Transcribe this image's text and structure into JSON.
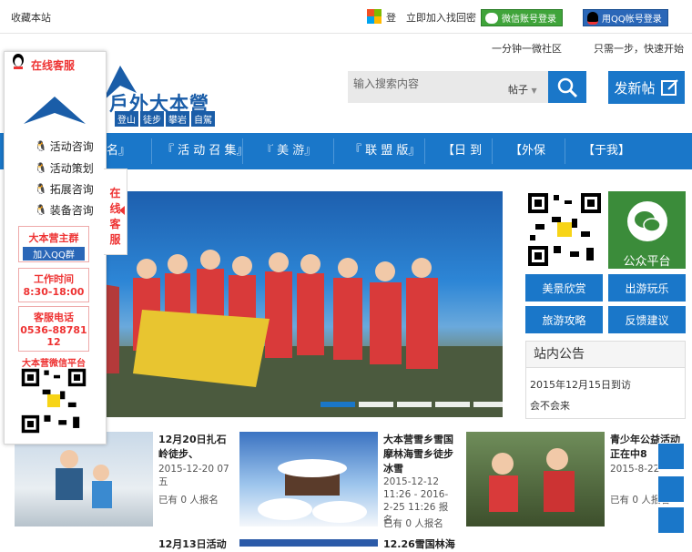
{
  "topbar": {
    "bookmark": "收藏本站",
    "login_link": "登",
    "join_link": "立即加入",
    "forgot_link": "找回密",
    "wechat_login": "微信账号登录",
    "qq_login": "用QQ帐号登录",
    "sub_left": "一分钟一微社区",
    "sub_right": "只需一步，快速开始"
  },
  "logo": {
    "title": "戶外大本營",
    "tags": [
      "登山",
      "徒步",
      "攀岩",
      "自駕"
    ]
  },
  "search": {
    "placeholder": "输入搜索内容",
    "type": "帖子",
    "post_button": "发新帖"
  },
  "nav": {
    "items": [
      "名』",
      "『 活 动 召 集』",
      "『 美 游』",
      "『 联 盟 版』",
      "【日 到",
      "【外保",
      "【于我】"
    ]
  },
  "sidebar_right": {
    "gzh_label": "公众平台",
    "tiles": [
      "美景欣赏",
      "出游玩乐",
      "旅游攻略",
      "反馈建议"
    ],
    "notice_title": "站内公告",
    "notices": [
      "2015年12月15日到访",
      "会不会来"
    ]
  },
  "posts": [
    {
      "title": "12月20日扎石岭徒步、",
      "date": "2015-12-20 07 五",
      "count": "已有 0 人报名"
    },
    {
      "title": "大本营雪乡雪国摩林海雪乡徒步冰雪",
      "date": "2015-12-12 11:26 - 2016-2-25 11:26 报名",
      "count": "已有 0 人报名"
    },
    {
      "title": "青少年公益活动正在中8",
      "date": "2015-8-22",
      "count": "已有 0 人报名"
    }
  ],
  "posts_row2": [
    "12月13日活动",
    "12.26雪国林海"
  ],
  "float_panel": {
    "header": "在线客服",
    "tab_text": "在线客服",
    "items": [
      "活动咨询",
      "活动策划",
      "拓展咨询",
      "装备咨询"
    ],
    "qq_group_title": "大本营主群",
    "qq_group_btn": "加入QQ群",
    "worktime_title": "工作时间",
    "worktime": "8:30-18:00",
    "phone_title": "客服电话",
    "phone": "0536-8878112",
    "wechat_title": "大本营微信平台"
  }
}
